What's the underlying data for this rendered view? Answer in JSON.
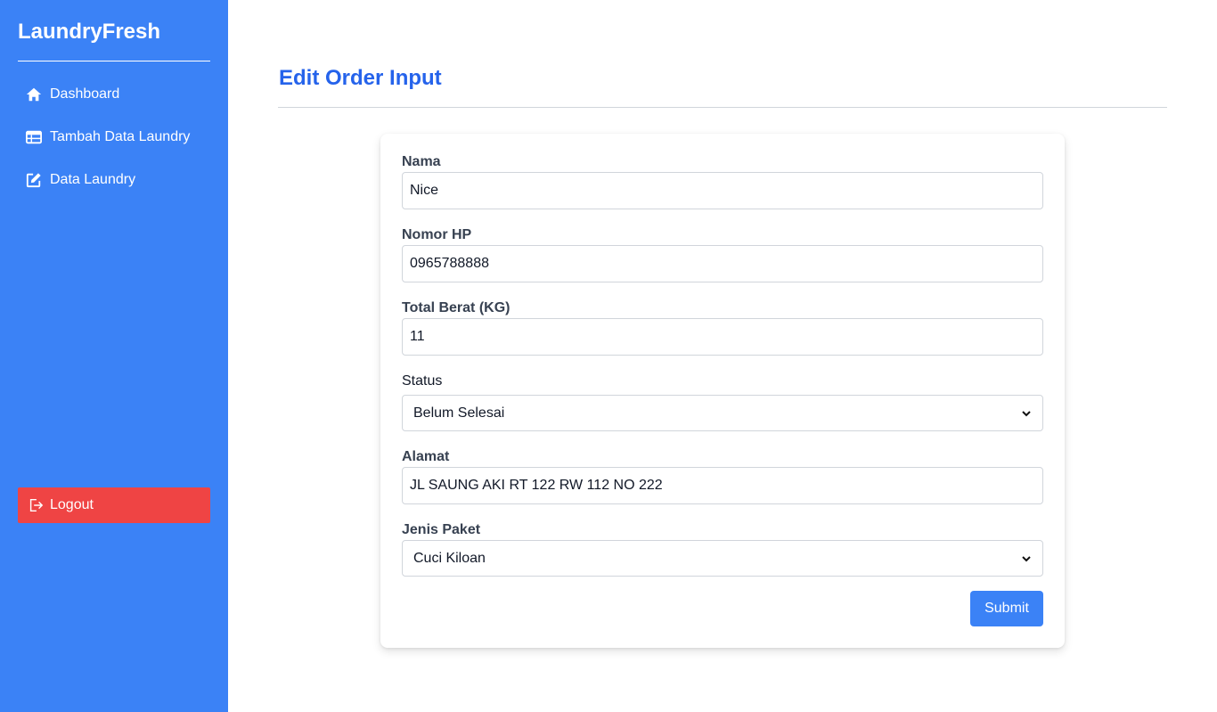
{
  "sidebar": {
    "brand": "LaundryFresh",
    "items": [
      {
        "label": "Dashboard",
        "icon": "home-icon"
      },
      {
        "label": "Tambah Data Laundry",
        "icon": "table-icon"
      },
      {
        "label": "Data Laundry",
        "icon": "edit-icon"
      }
    ],
    "logout_label": "Logout",
    "logout_icon": "logout-icon"
  },
  "page": {
    "title": "Edit Order Input"
  },
  "form": {
    "nama": {
      "label": "Nama",
      "value": "Nice"
    },
    "nomor_hp": {
      "label": "Nomor HP",
      "value": "0965788888"
    },
    "total_berat": {
      "label": "Total Berat (KG)",
      "value": "11"
    },
    "status": {
      "label": "Status",
      "value": "Belum Selesai"
    },
    "alamat": {
      "label": "Alamat",
      "value": "JL SAUNG AKI RT 122 RW 112 NO 222"
    },
    "jenis_paket": {
      "label": "Jenis Paket",
      "value": "Cuci Kiloan"
    },
    "submit_label": "Submit"
  },
  "colors": {
    "sidebar": "#3b82f6",
    "title": "#2563eb",
    "logout": "#ef4444",
    "submit": "#3b82f6"
  }
}
